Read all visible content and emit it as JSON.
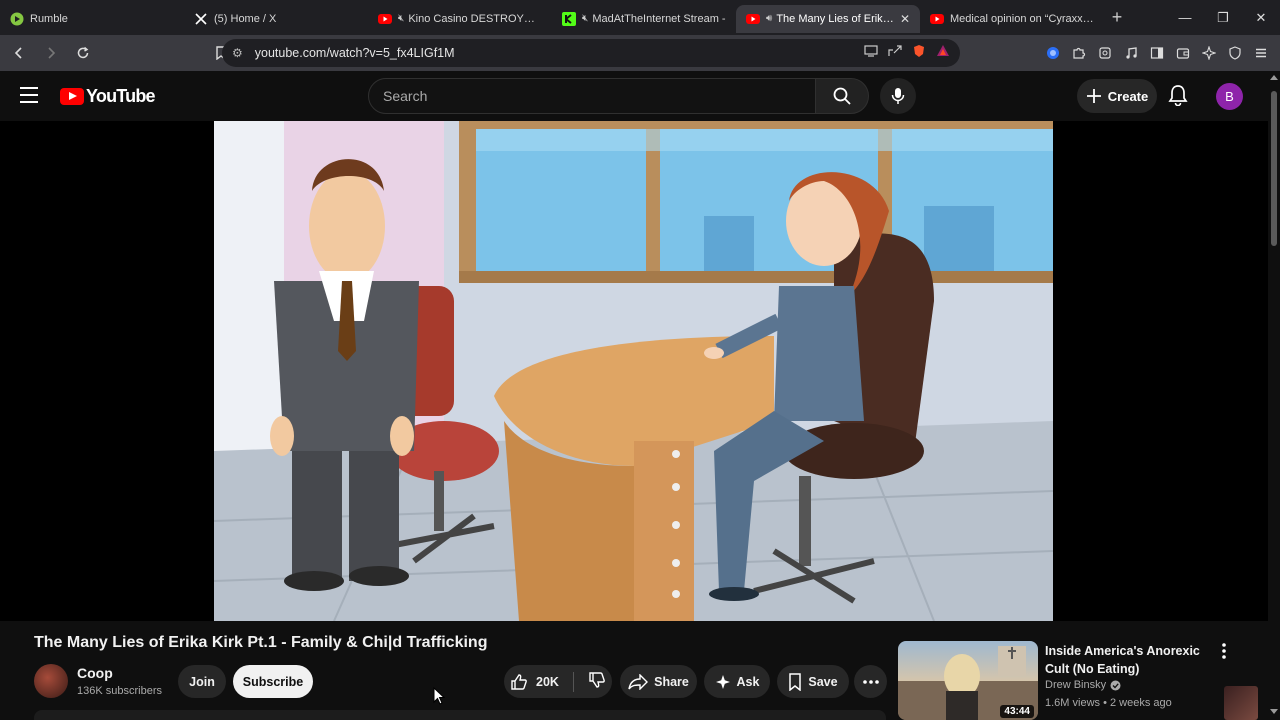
{
  "browser": {
    "tabs": [
      {
        "title": "Rumble",
        "active": false
      },
      {
        "title": "(5) Home / X",
        "active": false
      },
      {
        "title": "Kino Casino DESTROYS DSP",
        "active": false
      },
      {
        "title": "MadAtTheInternet Stream -",
        "active": false
      },
      {
        "title": "The Many Lies of Erika K",
        "active": true
      },
      {
        "title": "Medical opinion on “Cyraxx”’s m",
        "active": false
      }
    ],
    "url": "youtube.com/watch?v=5_fx4LIGf1M"
  },
  "header": {
    "logo_text": "YouTube",
    "search_placeholder": "Search",
    "create_label": "Create",
    "avatar_letter": "B"
  },
  "video": {
    "title": "The Many Lies of Erika Kirk Pt.1 - Family & Chi|d Trafficking",
    "channel": {
      "name": "Coop",
      "subscribers": "136K subscribers"
    },
    "join_label": "Join",
    "subscribe_label": "Subscribe",
    "like_count": "20K",
    "share_label": "Share",
    "ask_label": "Ask",
    "save_label": "Save"
  },
  "recommended": [
    {
      "title": "Inside America's Anorexic Cult (No Eating)",
      "channel": "Drew Binsky",
      "meta": "1.6M views • 2 weeks ago",
      "duration": "43:44"
    }
  ],
  "colors": {
    "brand_red": "#ff0000",
    "background": "#0f0f0f",
    "avatar": "#8e24aa"
  }
}
